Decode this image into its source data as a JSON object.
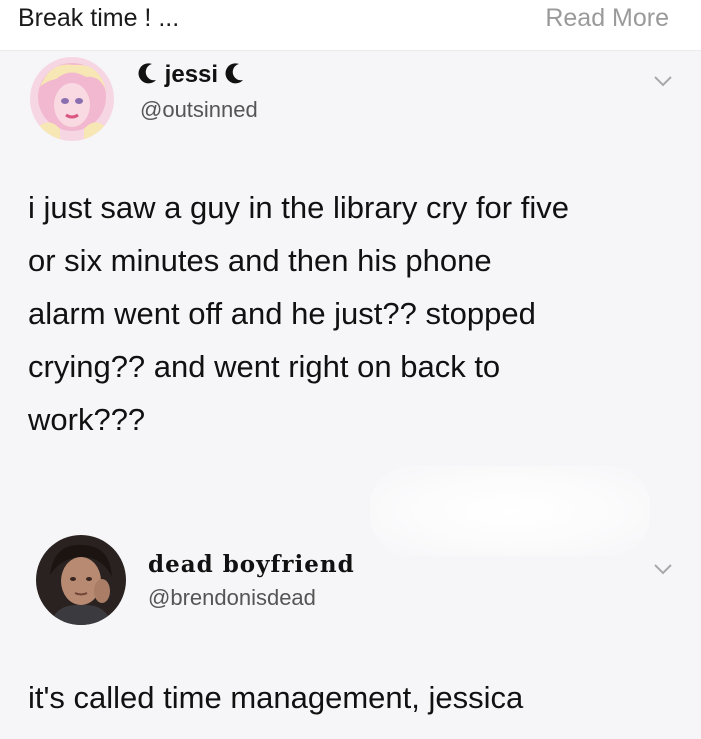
{
  "topbar": {
    "caption": "Break time ! ...",
    "read_more": "Read More"
  },
  "tweet1": {
    "display_name": "jessi",
    "handle": "@outsinned",
    "text_lines": [
      "i just saw a guy in the library cry for five",
      "or six minutes and then his phone",
      "alarm went off and he just?? stopped",
      "crying?? and went right on back to",
      "work???"
    ],
    "avatar_icon": "pink-doll-avatar",
    "menu_icon": "chevron-down-icon"
  },
  "tweet2": {
    "display_name": "dead boyfriend",
    "handle": "@brendonisdead",
    "text": "it's called time management, jessica",
    "avatar_icon": "person-photo-avatar",
    "menu_icon": "chevron-down-icon"
  },
  "colors": {
    "background": "#f6f5f7",
    "topbar_bg": "#ffffff",
    "read_more": "#9a9a9a",
    "handle": "#555555",
    "avatar_pink": "#f2b8cf"
  }
}
